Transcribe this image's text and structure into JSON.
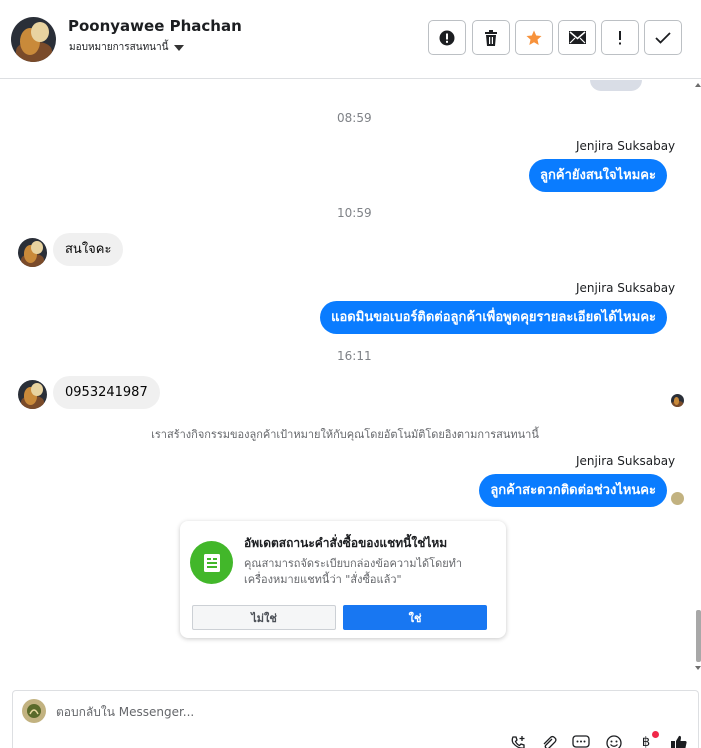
{
  "header": {
    "contact_name": "Poonyawee Phachan",
    "assign_label": "มอบหมายการสนทนานี้",
    "toolbar": [
      {
        "name": "report-spam-button",
        "icon": "exclamation-circle-icon"
      },
      {
        "name": "delete-button",
        "icon": "trash-icon"
      },
      {
        "name": "star-button",
        "icon": "star-icon",
        "color": "#f7923b"
      },
      {
        "name": "mark-unread-button",
        "icon": "envelope-icon"
      },
      {
        "name": "follow-up-button",
        "icon": "exclamation-icon"
      },
      {
        "name": "mark-done-button",
        "icon": "check-icon"
      }
    ]
  },
  "chat": {
    "time_1": "08:59",
    "sender_1": "Jenjira Suksabay",
    "msg_out_1": "ลูกค้ายังสนใจไหมคะ",
    "time_2": "10:59",
    "msg_in_1": "สนใจคะ",
    "sender_2": "Jenjira Suksabay",
    "msg_out_2": "แอดมินขอเบอร์ติดต่อลูกค้าเพื่อพูดคุยรายละเอียดได้ไหมคะ",
    "time_3": "16:11",
    "msg_in_2": "0953241987",
    "system_note": "เราสร้างกิจกรรมของลูกค้าเป้าหมายให้กับคุณโดยอัตโนมัติโดยอิงตามการสนทนานี้",
    "sender_3": "Jenjira Suksabay",
    "msg_out_3": "ลูกค้าสะดวกติดต่อช่วงไหนคะ",
    "accent_color": "#0a7cff"
  },
  "order_card": {
    "title": "อัพเดตสถานะคำสั่งซื้อของแชทนี้ใช่ไหม",
    "description": "คุณสามารถจัดระเบียบกล่องข้อความได้โดยทำเครื่องหมายแชทนี้ว่า \"สั่งซื้อแล้ว\"",
    "no_label": "ไม่ใช่",
    "yes_label": "ใช่",
    "icon": "receipt-icon",
    "icon_color": "#42b72a"
  },
  "composer": {
    "placeholder": "ตอบกลับใน Messenger...",
    "icons": [
      "add-contact-icon",
      "attachment-icon",
      "saved-reply-icon",
      "emoji-icon",
      "baht-payment-icon",
      "like-icon"
    ]
  }
}
